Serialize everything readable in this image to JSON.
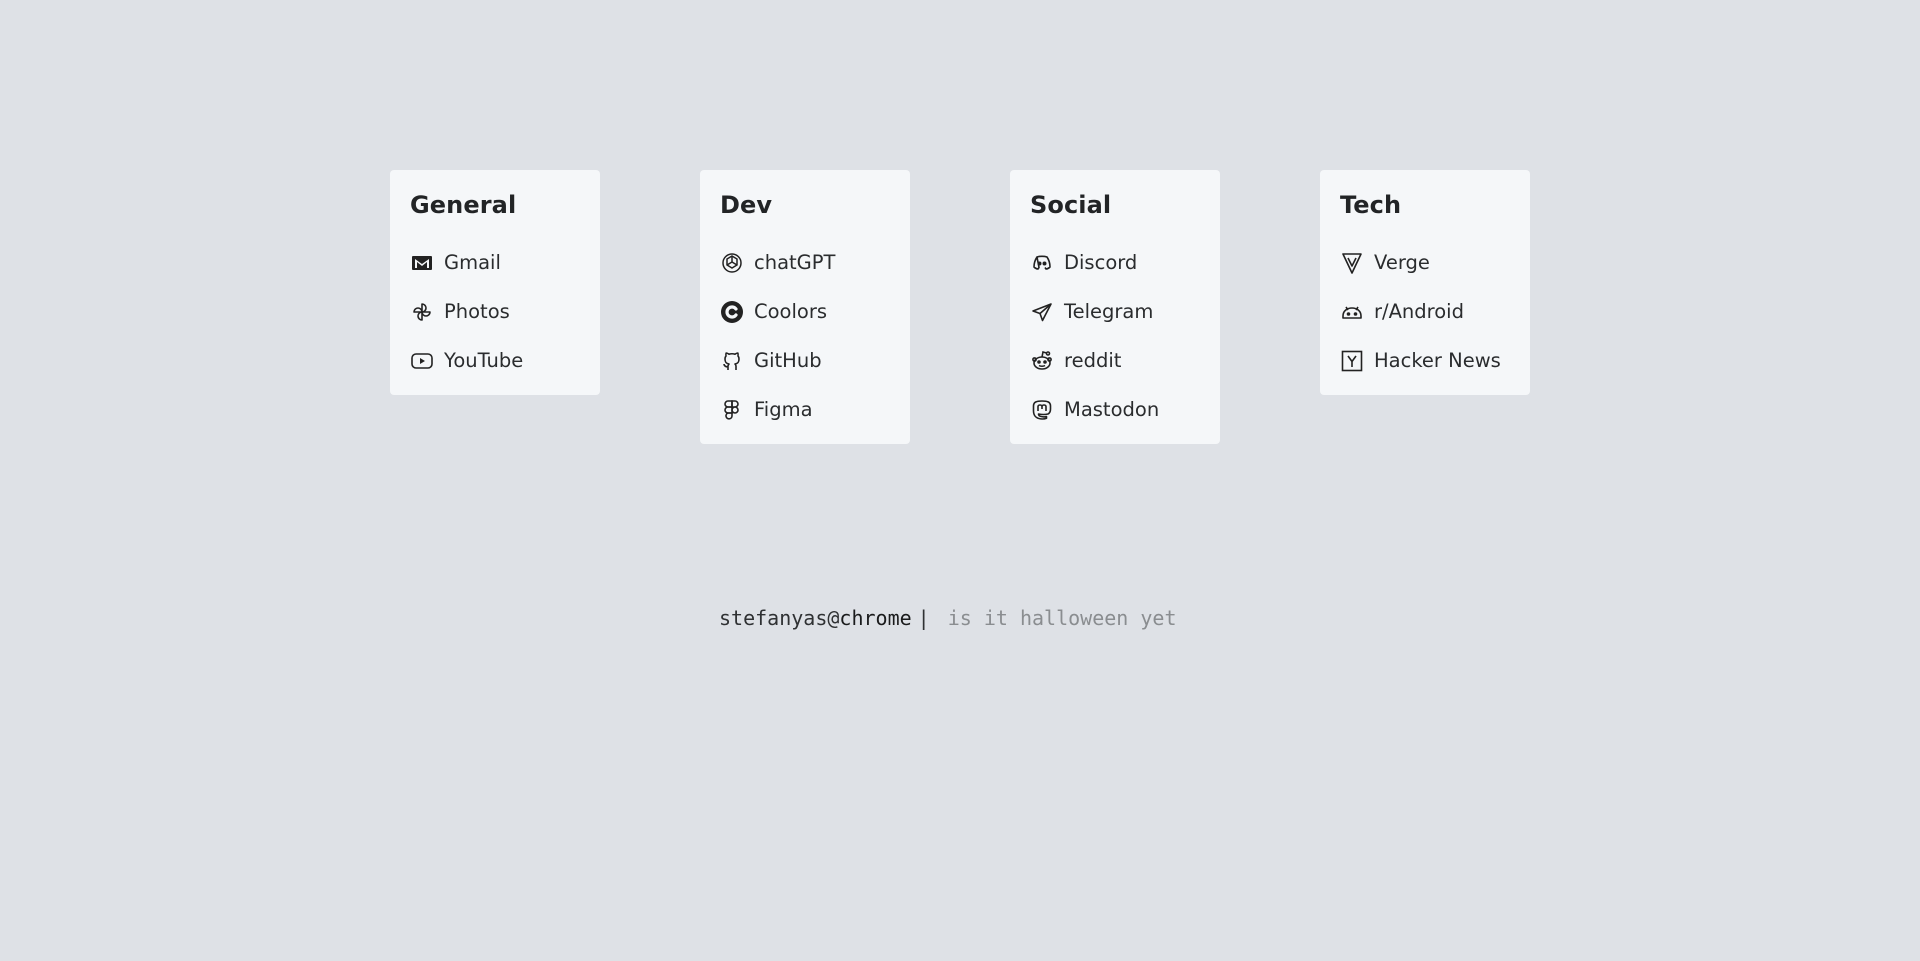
{
  "groups": [
    {
      "title": "General",
      "links": [
        {
          "label": "Gmail",
          "icon": "gmail-icon"
        },
        {
          "label": "Photos",
          "icon": "photos-icon"
        },
        {
          "label": "YouTube",
          "icon": "youtube-icon"
        }
      ]
    },
    {
      "title": "Dev",
      "links": [
        {
          "label": "chatGPT",
          "icon": "openai-icon"
        },
        {
          "label": "Coolors",
          "icon": "coolors-icon"
        },
        {
          "label": "GitHub",
          "icon": "github-icon"
        },
        {
          "label": "Figma",
          "icon": "figma-icon"
        }
      ]
    },
    {
      "title": "Social",
      "links": [
        {
          "label": "Discord",
          "icon": "discord-icon"
        },
        {
          "label": "Telegram",
          "icon": "telegram-icon"
        },
        {
          "label": "reddit",
          "icon": "reddit-icon"
        },
        {
          "label": "Mastodon",
          "icon": "mastodon-icon"
        }
      ]
    },
    {
      "title": "Tech",
      "links": [
        {
          "label": "Verge",
          "icon": "verge-icon"
        },
        {
          "label": "r/Android",
          "icon": "android-icon"
        },
        {
          "label": "Hacker News",
          "icon": "hackernews-icon"
        }
      ]
    }
  ],
  "prompt": {
    "user": "stefanyas@",
    "host": "chrome",
    "separator": "|",
    "search_placeholder": "is it halloween yet"
  },
  "colors": {
    "background": "#dee1e6",
    "card": "#f5f7f9",
    "text": "#222426",
    "placeholder": "#8a8d90"
  }
}
